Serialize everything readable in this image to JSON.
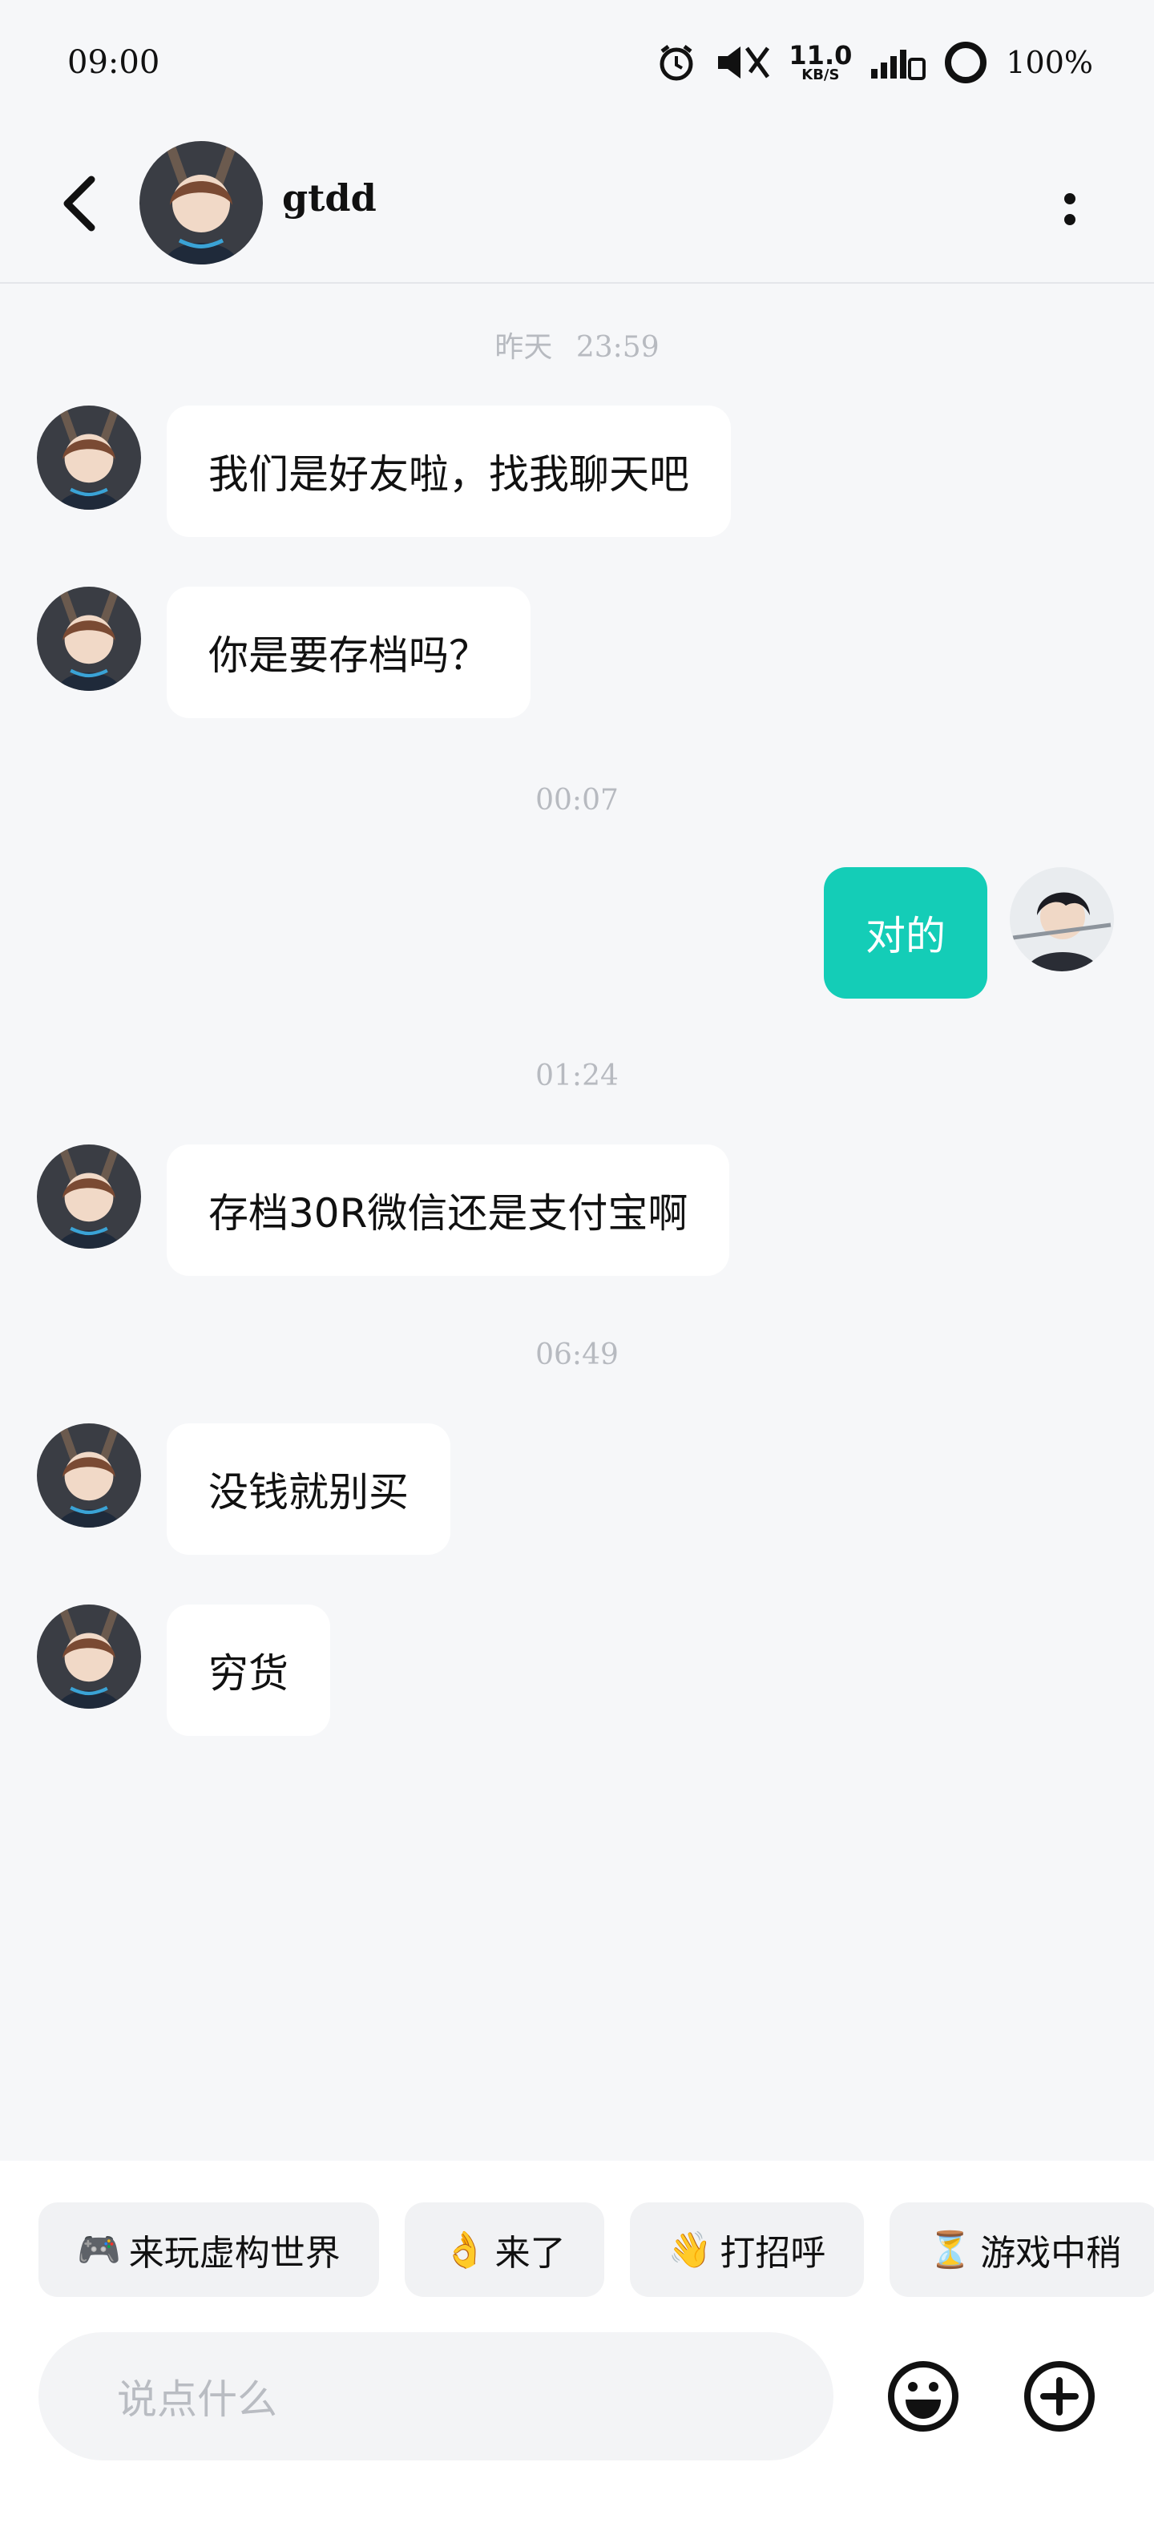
{
  "status_bar": {
    "time": "09:00",
    "net_speed_value": "11.0",
    "net_speed_unit": "KB/S",
    "battery": "100%",
    "icons": [
      "alarm-icon",
      "mute-icon",
      "network-speed",
      "signal-icon",
      "battery-ring-icon"
    ]
  },
  "header": {
    "name": "gtdd",
    "back_icon": "chevron-left-icon",
    "more_icon": "more-vertical-icon"
  },
  "messages": [
    {
      "type": "timestamp",
      "day": "昨天",
      "time": "23:59"
    },
    {
      "type": "message",
      "side": "in",
      "text": "我们是好友啦，找我聊天吧"
    },
    {
      "type": "message",
      "side": "in",
      "text": "你是要存档吗？"
    },
    {
      "type": "timestamp",
      "time": "00:07"
    },
    {
      "type": "message",
      "side": "out",
      "text": "对的"
    },
    {
      "type": "timestamp",
      "time": "01:24"
    },
    {
      "type": "message",
      "side": "in",
      "text": "存档30R微信还是支付宝啊"
    },
    {
      "type": "timestamp",
      "time": "06:49"
    },
    {
      "type": "message",
      "side": "in",
      "text": "没钱就别买"
    },
    {
      "type": "message",
      "side": "in",
      "text": "穷货"
    }
  ],
  "quick_replies": [
    {
      "emoji": "🎮",
      "label": "来玩虚构世界"
    },
    {
      "emoji": "👌",
      "label": "来了"
    },
    {
      "emoji": "👋",
      "label": "打招呼"
    },
    {
      "emoji": "⏳",
      "label": "游戏中稍"
    }
  ],
  "input": {
    "placeholder": "说点什么",
    "emoji_icon": "smiley-icon",
    "plus_icon": "plus-circle-icon"
  },
  "colors": {
    "background": "#f6f7f9",
    "outgoing_bubble": "#14cdb7",
    "incoming_bubble": "#ffffff",
    "timestamp": "#b7bac0"
  }
}
